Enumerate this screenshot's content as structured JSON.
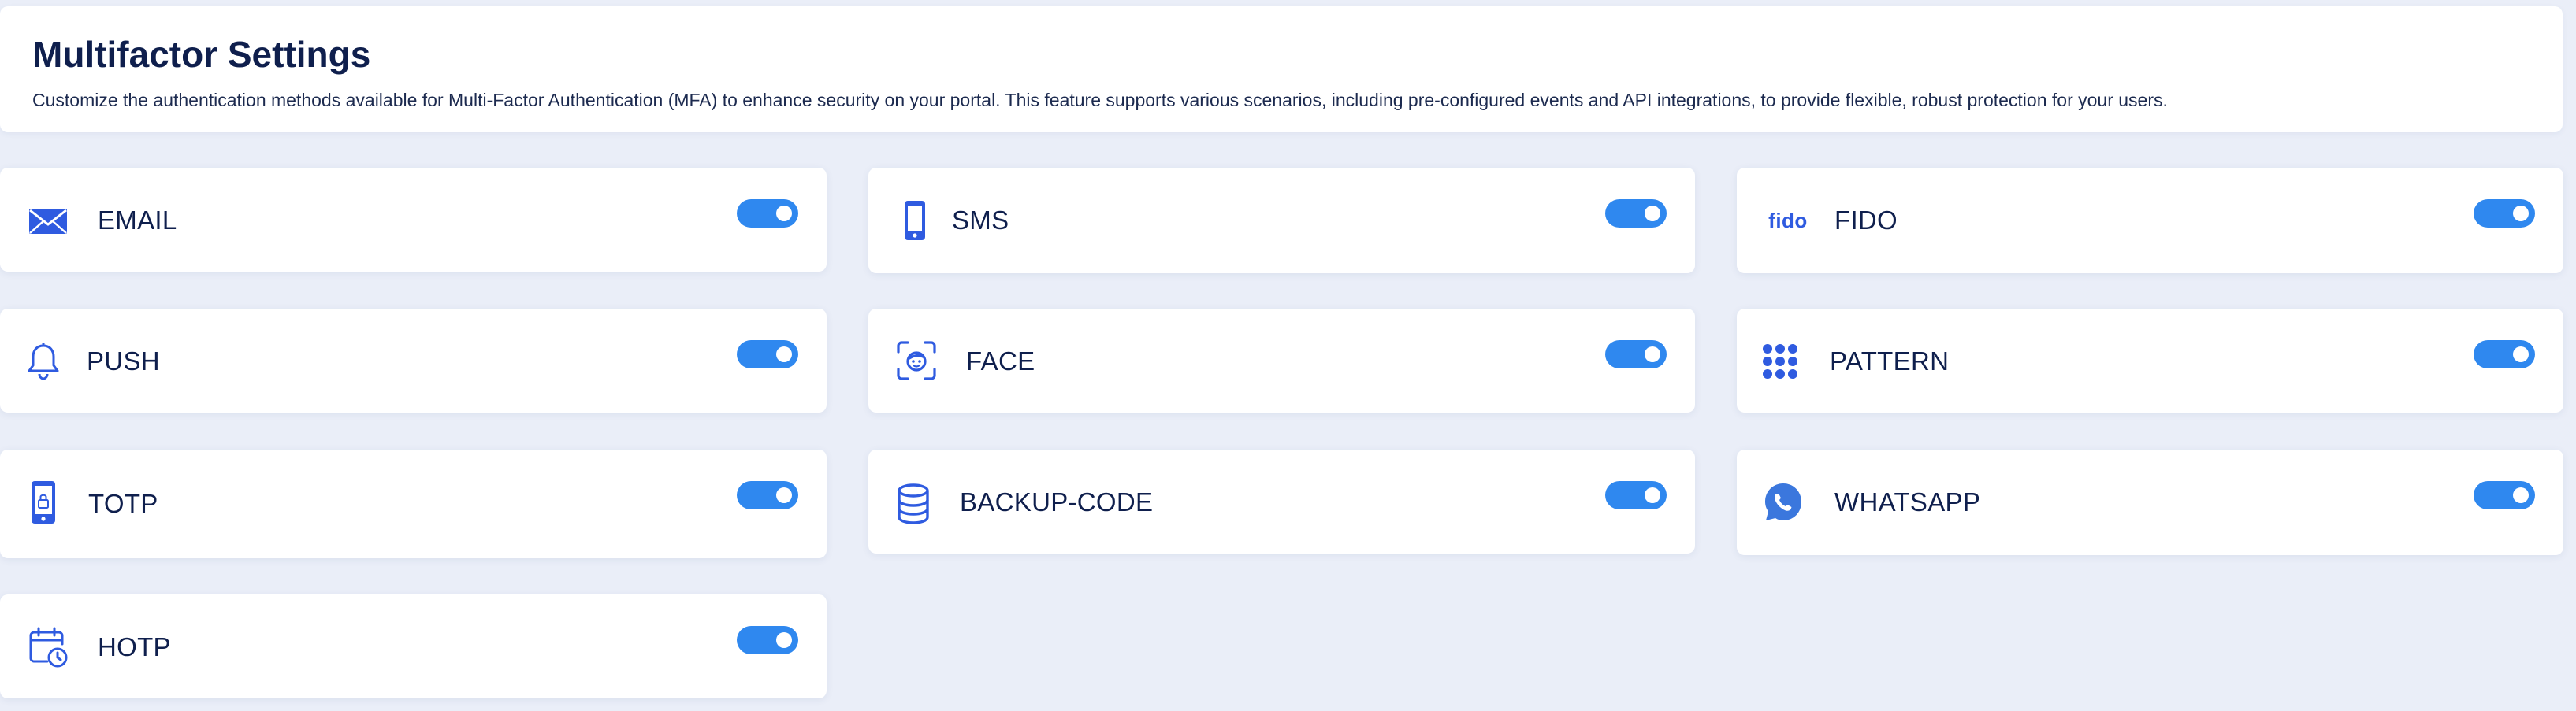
{
  "header": {
    "title": "Multifactor Settings",
    "description": "Customize the authentication methods available for Multi-Factor Authentication (MFA) to enhance security on your portal. This feature supports various scenarios, including pre-configured events and API integrations, to provide flexible, robust protection for your users."
  },
  "colors": {
    "accent": "#2f88ef",
    "icon": "#2f5be0",
    "background": "#eaeef8"
  },
  "methods": [
    {
      "label": "EMAIL",
      "icon": "envelope-icon",
      "enabled": true
    },
    {
      "label": "SMS",
      "icon": "mobile-phone-icon",
      "enabled": true
    },
    {
      "label": "FIDO",
      "icon": "fido-logo-icon",
      "icon_text": "fido",
      "enabled": true
    },
    {
      "label": "PUSH",
      "icon": "bell-icon",
      "enabled": true
    },
    {
      "label": "FACE",
      "icon": "face-scan-icon",
      "enabled": true
    },
    {
      "label": "PATTERN",
      "icon": "dot-grid-icon",
      "enabled": true
    },
    {
      "label": "TOTP",
      "icon": "phone-lock-icon",
      "enabled": true
    },
    {
      "label": "BACKUP-CODE",
      "icon": "database-icon",
      "enabled": true
    },
    {
      "label": "WHATSAPP",
      "icon": "whatsapp-icon",
      "enabled": true
    },
    {
      "label": "HOTP",
      "icon": "calendar-clock-icon",
      "enabled": true
    }
  ]
}
